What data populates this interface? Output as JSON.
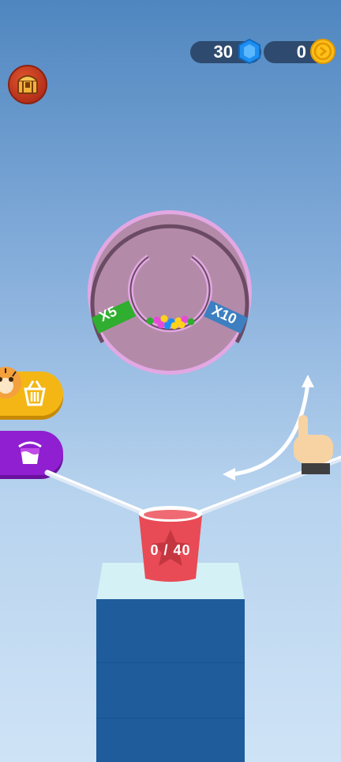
{
  "currency": {
    "gems": "30",
    "coins": "0",
    "gem_icon": "blue-gem-icon",
    "coin_icon": "gold-coin-icon"
  },
  "wheel": {
    "multipliers": [
      "X5",
      "X10"
    ],
    "ball_colors": [
      "#2fae2f",
      "#e64bd9",
      "#ffd21a",
      "#1e8ff0",
      "#ffd21a",
      "#e64bd9",
      "#2fae2f",
      "#1e8ff0",
      "#ffd21a",
      "#ffd21a",
      "#e64bd9"
    ]
  },
  "cup": {
    "progress": "0 / 40",
    "filled": 0,
    "target": 40
  },
  "buttons": {
    "shop_icon": "basket-icon",
    "paint_icon": "paint-bucket-icon",
    "chest_icon": "treasure-chest-icon"
  },
  "colors": {
    "shop": "#f3b614",
    "paint": "#8f1fd0",
    "wheel": "#b48aa9",
    "cup": "#e84b55",
    "pedestal": "#1e5c9c"
  }
}
